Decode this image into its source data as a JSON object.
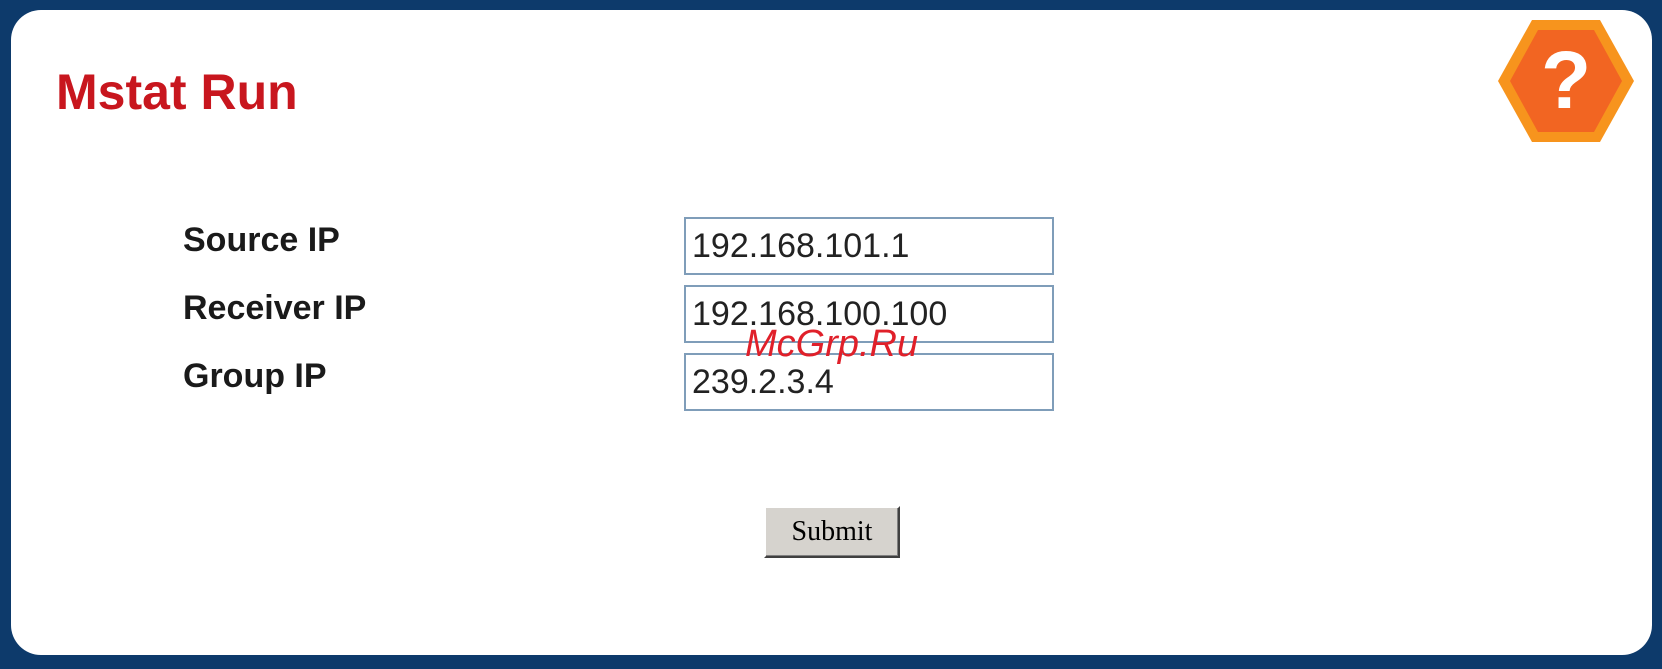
{
  "page": {
    "title": "Mstat Run"
  },
  "help_icon": {
    "icon": "question-mark-hexagon-icon",
    "glyph": "?",
    "fill_color": "#f26522",
    "border_color": "#f7941d"
  },
  "form": {
    "fields": [
      {
        "label": "Source IP",
        "value": "192.168.101.1"
      },
      {
        "label": "Receiver IP",
        "value": "192.168.100.100"
      },
      {
        "label": "Group IP",
        "value": "239.2.3.4"
      }
    ],
    "submit_label": "Submit"
  },
  "watermark": {
    "text": "McGrp.Ru"
  },
  "colors": {
    "frame": "#0d3a6b",
    "title": "#c8161e",
    "input_border": "#7f9db9",
    "button_face": "#d6d3ce"
  }
}
